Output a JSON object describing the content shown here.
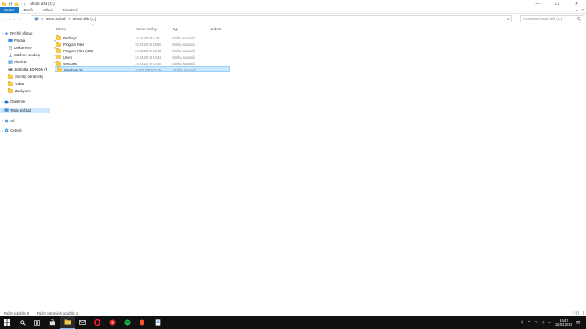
{
  "window": {
    "title": "Místní disk (C:)",
    "controls": {
      "minimize": "—",
      "maximize": "☐",
      "close": "✕"
    }
  },
  "ribbon": {
    "tabs": [
      "Soubor",
      "Domů",
      "Sdílení",
      "Zobrazení"
    ],
    "right": {
      "collapse": "⌄",
      "help": "?"
    }
  },
  "nav": {
    "back": "←",
    "forward": "→",
    "up_history": "⌄",
    "up": "↑",
    "breadcrumb": [
      "Tento počítač",
      "Místní disk (C:)"
    ],
    "separator": ">",
    "refresh": "↻",
    "search_placeholder": "Prohledat: Místní disk (C:)"
  },
  "sidebar": {
    "items": [
      {
        "label": "Rychlý přístup",
        "icon": "star-icon",
        "pinned": false
      },
      {
        "label": "Plocha",
        "icon": "desktop-icon",
        "pinned": true
      },
      {
        "label": "Dokumenty",
        "icon": "documents-icon",
        "pinned": true
      },
      {
        "label": "Stažené soubory",
        "icon": "download-icon",
        "pinned": true
      },
      {
        "label": "Obrázky",
        "icon": "pictures-icon",
        "pinned": true
      },
      {
        "label": "Jednotka BD-ROM (F",
        "icon": "disc-drive-icon",
        "pinned": false
      },
      {
        "label": "Snímky obrazovky",
        "icon": "folder-icon",
        "pinned": false
      },
      {
        "label": "Videa",
        "icon": "folder-icon",
        "pinned": false
      },
      {
        "label": "Zachycení",
        "icon": "folder-icon",
        "pinned": false
      },
      {
        "label": "OneDrive",
        "icon": "cloud-icon",
        "pinned": false
      },
      {
        "label": "Tento počítač",
        "icon": "computer-icon",
        "pinned": false
      },
      {
        "label": "Síť",
        "icon": "network-icon",
        "pinned": false
      },
      {
        "label": "Cetché",
        "icon": "homegroup-icon",
        "pinned": false
      }
    ],
    "pin_glyph": "📌"
  },
  "columns": [
    "Název",
    "Datum změny",
    "Typ",
    "Velikost"
  ],
  "sort_indicator": "^",
  "files": [
    {
      "name": "PerfLogs",
      "date": "12.04.2018 1:38",
      "type": "Složka souborů"
    },
    {
      "name": "Program Files",
      "date": "15.03.2019 15:59",
      "type": "Složka souborů"
    },
    {
      "name": "Program Files (x86)",
      "date": "14.03.2019 23:42",
      "type": "Složka souborů"
    },
    {
      "name": "Users",
      "date": "14.03.2019 23:42",
      "type": "Složka souborů"
    },
    {
      "name": "Windows",
      "date": "14.03.2019 23:46",
      "type": "Složka souborů"
    },
    {
      "name": "Windows.old",
      "date": "14.03.2019 23:46",
      "type": "Složka souborů"
    }
  ],
  "status": {
    "count": "Počet položek: 6",
    "selected": "Počet vybraných položek: 1"
  },
  "taskbar": {
    "apps": [
      "windows-start-icon",
      "search-icon",
      "task-view-icon",
      "store-icon",
      "file-explorer-icon",
      "mail-icon",
      "opera-icon",
      "music-app-icon",
      "spotify-icon",
      "brave-icon",
      "file-icon"
    ],
    "clock_time": "14:47",
    "clock_date": "15.03.2019"
  },
  "colors": {
    "accent": "#1979ca",
    "selection": "#cce8ff",
    "folder": "#f6c94a",
    "taskbar": "#101010"
  }
}
